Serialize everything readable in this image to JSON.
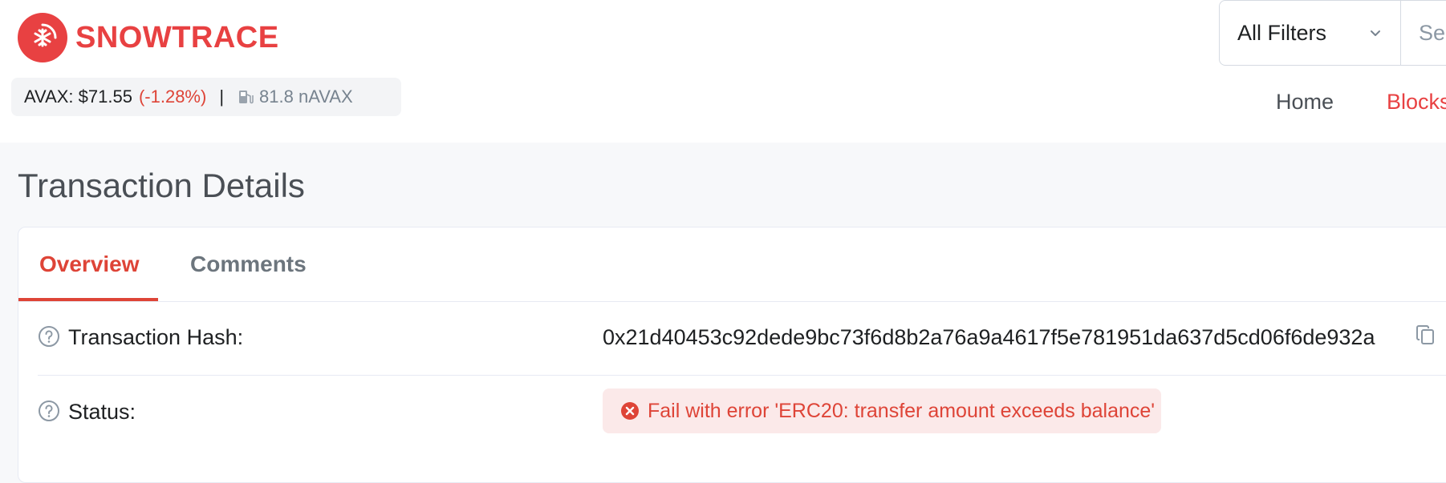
{
  "brand": {
    "name": "SNOWTRACE",
    "color": "#e84142"
  },
  "ticker": {
    "price": "AVAX: $71.55",
    "change": "(-1.28%)",
    "separator": "|",
    "gas_icon": "gas-pump-icon",
    "gas": "81.8 nAVAX"
  },
  "search": {
    "filter_label": "All Filters",
    "placeholder": "Se"
  },
  "nav": {
    "home": "Home",
    "blocks": "Blocks"
  },
  "page": {
    "title": "Transaction Details"
  },
  "tabs": [
    {
      "label": "Overview",
      "active": true
    },
    {
      "label": "Comments",
      "active": false
    }
  ],
  "details": {
    "hash_label": "Transaction Hash:",
    "hash_value": "0x21d40453c92dede9bc73f6d8b2a76a9a4617f5e781951da637d5cd06f6de932a",
    "status_label": "Status:",
    "status_value": "Fail with error 'ERC20: transfer amount exceeds balance'",
    "status_color": "#de4437"
  }
}
